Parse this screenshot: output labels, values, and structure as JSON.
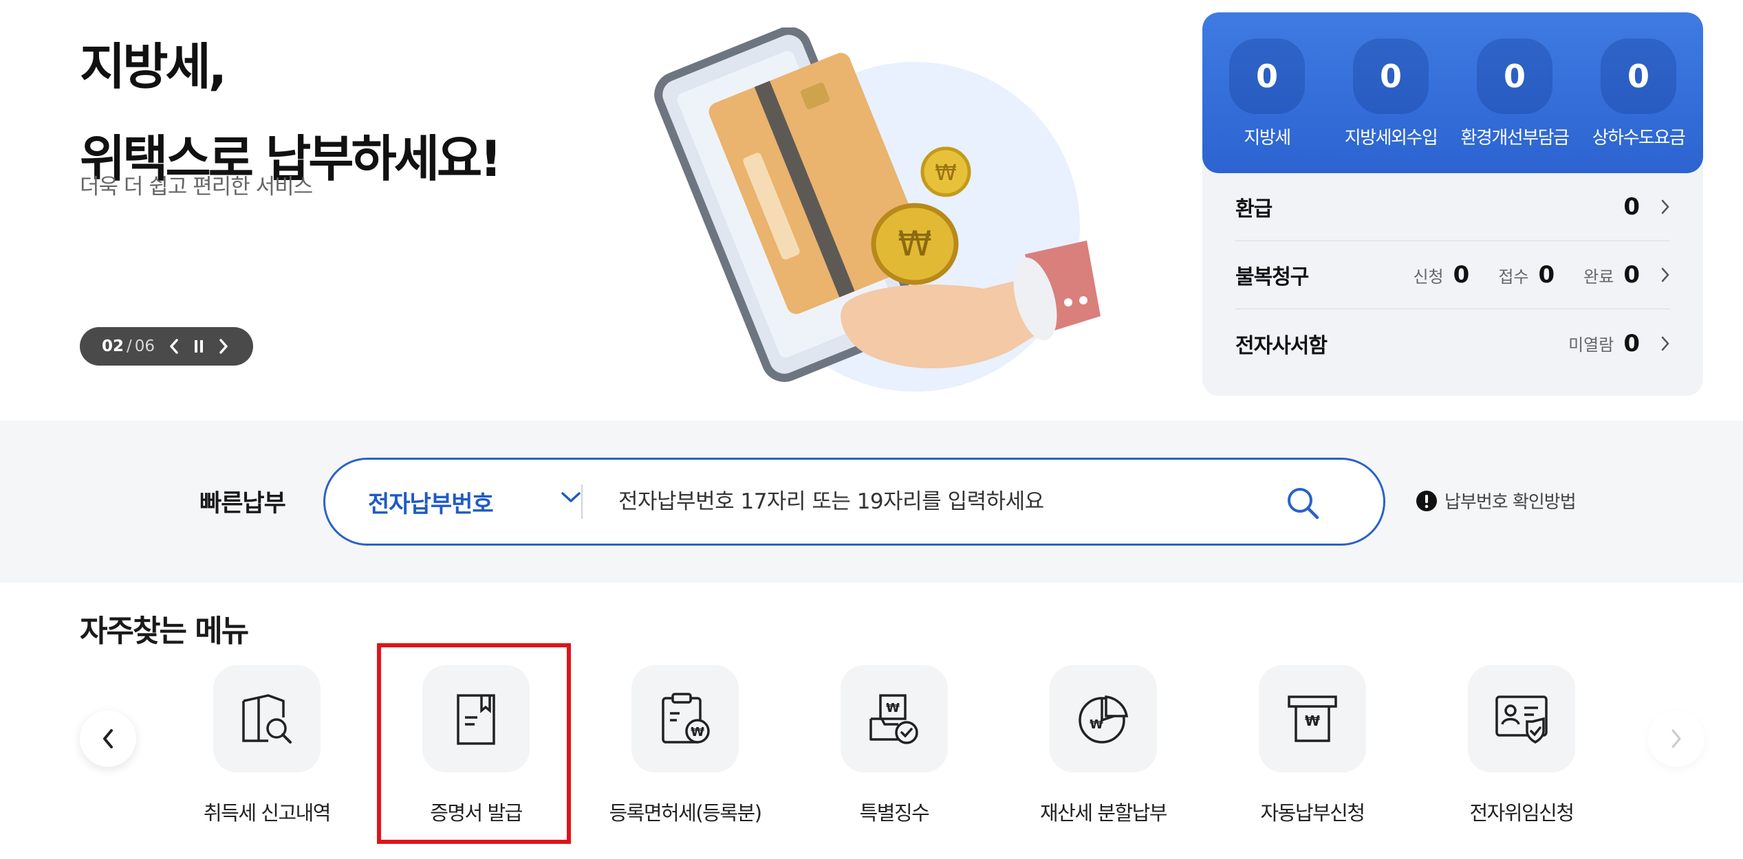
{
  "hero": {
    "title_line1": "지방세,",
    "title_line2": "위택스로 납부하세요!",
    "subtitle": "더욱 더 쉽고 편리한 서비스",
    "slider": {
      "current": "02",
      "separator": "/",
      "total": "06"
    }
  },
  "summary": {
    "stats": [
      {
        "value": "0",
        "label": "지방세"
      },
      {
        "value": "0",
        "label": "지방세외수입"
      },
      {
        "value": "0",
        "label": "환경개선부담금"
      },
      {
        "value": "0",
        "label": "상하수도요금"
      }
    ],
    "refund": {
      "title": "환급",
      "value": "0"
    },
    "appeal": {
      "title": "불복청구",
      "applied_label": "신청",
      "applied": "0",
      "received_label": "접수",
      "received": "0",
      "done_label": "완료",
      "done": "0"
    },
    "mailbox": {
      "title": "전자사서함",
      "unread_label": "미열람",
      "unread": "0"
    }
  },
  "quick_pay": {
    "label": "빠른납부",
    "type_selected": "전자납부번호",
    "placeholder": "전자납부번호 17자리 또는 19자리를 입력하세요",
    "help": "납부번호 확인방법"
  },
  "frequent_menu": {
    "title": "자주찾는 메뉴",
    "items": [
      {
        "label": "취득세 신고내역",
        "icon": "building-search-icon"
      },
      {
        "label": "증명서 발급",
        "icon": "document-bookmark-icon"
      },
      {
        "label": "등록면허세(등록분)",
        "icon": "clipboard-won-icon"
      },
      {
        "label": "특별징수",
        "icon": "tray-check-icon"
      },
      {
        "label": "재산세 분할납부",
        "icon": "pie-chart-won-icon"
      },
      {
        "label": "자동납부신청",
        "icon": "atm-won-icon"
      },
      {
        "label": "전자위임신청",
        "icon": "id-card-shield-icon"
      }
    ]
  },
  "colors": {
    "brand_blue": "#2c63d1",
    "highlight_red": "#e0141b"
  }
}
